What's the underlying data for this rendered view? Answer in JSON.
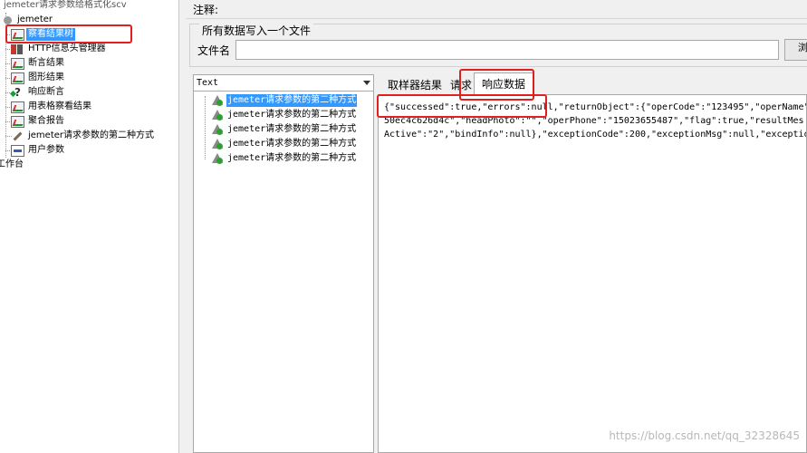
{
  "tree": {
    "root_label": "jemeter请求参数给格式化scv",
    "plan_label": "jemeter",
    "items": [
      {
        "label": "察看结果树",
        "icon": "listener-icon",
        "selected": true
      },
      {
        "label": "HTTP信息头管理器",
        "icon": "http-header-icon",
        "selected": false
      },
      {
        "label": "断言结果",
        "icon": "listener-icon",
        "selected": false
      },
      {
        "label": "图形结果",
        "icon": "listener-icon",
        "selected": false
      },
      {
        "label": "响应断言",
        "icon": "assertion-icon",
        "selected": false
      },
      {
        "label": "用表格察看结果",
        "icon": "listener-icon",
        "selected": false
      },
      {
        "label": "聚合报告",
        "icon": "listener-icon",
        "selected": false
      },
      {
        "label": "jemeter请求参数的第二种方式",
        "icon": "pencil-icon",
        "selected": false
      },
      {
        "label": "用户参数",
        "icon": "config-icon",
        "selected": false
      }
    ],
    "workbench_label": "工作台"
  },
  "comment": {
    "label": "注释:"
  },
  "file_section": {
    "title": "所有数据写入一个文件",
    "file_label": "文件名",
    "file_value": "",
    "browse_label": "浏"
  },
  "result_list": {
    "renderer": "Text",
    "rows": [
      {
        "label": "jemeter请求参数的第二种方式",
        "selected": true
      },
      {
        "label": "jemeter请求参数的第二种方式",
        "selected": false
      },
      {
        "label": "jemeter请求参数的第二种方式",
        "selected": false
      },
      {
        "label": "jemeter请求参数的第二种方式",
        "selected": false
      },
      {
        "label": "jemeter请求参数的第二种方式",
        "selected": false
      }
    ]
  },
  "detail": {
    "tabs": [
      {
        "label": "取样器结果",
        "active": false
      },
      {
        "label": "请求",
        "active": false
      },
      {
        "label": "响应数据",
        "active": true
      }
    ],
    "response_lines": [
      "{\"successed\":true,\"errors\":null,\"returnObject\":{\"operCode\":\"123495\",\"operName\"",
      "50ec4c626d4c\",\"headPhoto\":\"\",\"operPhone\":\"15023655487\",\"flag\":true,\"resultMes",
      "Active\":\"2\",\"bindInfo\":null},\"exceptionCode\":200,\"exceptionMsg\":null,\"exceptio"
    ]
  },
  "annotation_color": "#e02020",
  "selection_color": "#3399ff",
  "watermark": "https://blog.csdn.net/qq_32328645"
}
